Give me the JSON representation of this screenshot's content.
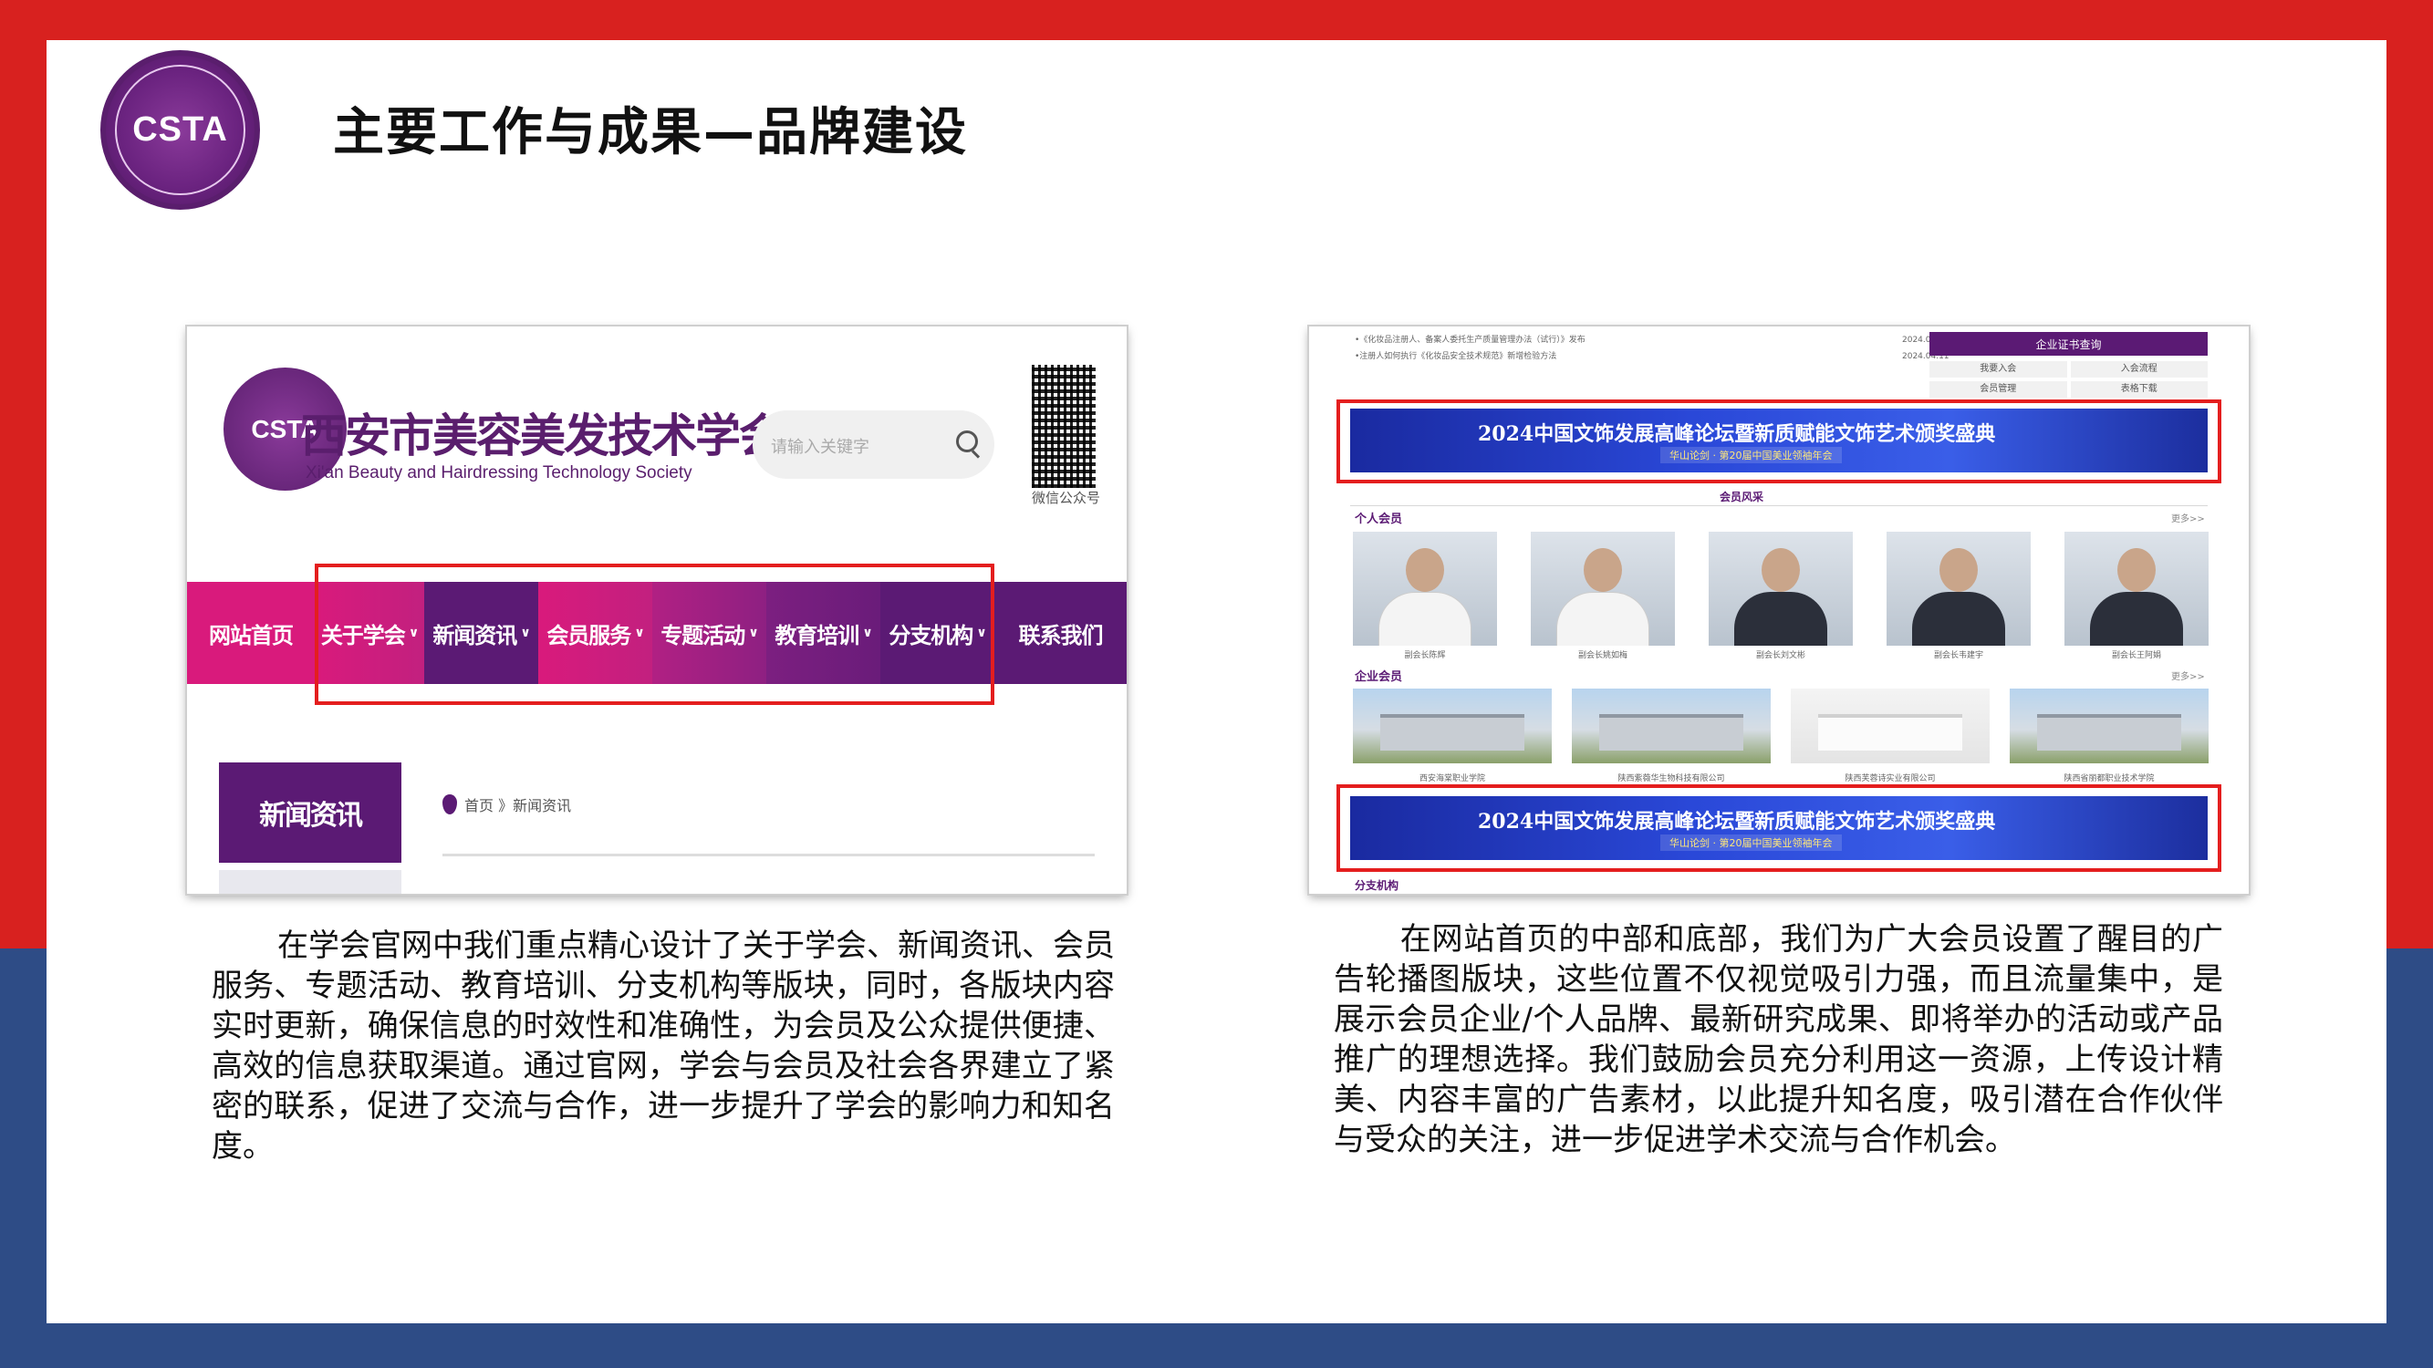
{
  "slide": {
    "title": "主要工作与成果—品牌建设",
    "logo_text": "CSTA",
    "colors": {
      "top_band": "#d8211f",
      "bottom_band": "#2e4c86",
      "brand_purple": "#5b1a74",
      "brand_pink": "#d91a7c",
      "highlight_red": "#e41e1e"
    }
  },
  "shot1": {
    "logo_text": "CSTA",
    "site_name": "西安市美容美发技术学会",
    "site_name_en": "Xi'an Beauty and Hairdressing Technology Society",
    "search_placeholder": "请输入关键字",
    "qr_label": "微信公众号",
    "nav": [
      {
        "label": "网站首页",
        "chevron": ""
      },
      {
        "label": "关于学会",
        "chevron": "∨"
      },
      {
        "label": "新闻资讯",
        "chevron": "∨"
      },
      {
        "label": "会员服务",
        "chevron": "∨"
      },
      {
        "label": "专题活动",
        "chevron": "∨"
      },
      {
        "label": "教育培训",
        "chevron": "∨"
      },
      {
        "label": "分支机构",
        "chevron": "∨"
      },
      {
        "label": "联系我们",
        "chevron": ""
      }
    ],
    "sidebar_tab": "新闻资讯",
    "breadcrumb": "首页 》新闻资讯"
  },
  "shot2": {
    "news": [
      {
        "title": "•《化妆品注册人、备案人委托生产质量管理办法（试行）》发布",
        "date": "2024.04.20"
      },
      {
        "title": "•注册人如何执行《化妆品安全技术规范》新增检验方法",
        "date": "2024.04.11"
      }
    ],
    "cert_title": "企业证书查询",
    "cert_links": [
      "我要入会",
      "入会流程",
      "会员管理",
      "表格下载"
    ],
    "banner_title": "2024中国文饰发展高峰论坛暨新质赋能文饰艺术颁奖盛典",
    "banner_sub": "华山论剑 · 第20届中国美业领袖年会",
    "members_title": "会员风采",
    "individual_title": "个人会员",
    "more": "更多>>",
    "persons": [
      {
        "caption": "副会长陈辉",
        "outfit": "white"
      },
      {
        "caption": "副会长姚如梅",
        "outfit": "white"
      },
      {
        "caption": "副会长刘文彬",
        "outfit": "dark"
      },
      {
        "caption": "副会长韦建宇",
        "outfit": "dark"
      },
      {
        "caption": "副会长王阿娟",
        "outfit": "dark"
      }
    ],
    "enterprise_title": "企业会员",
    "companies": [
      {
        "caption": "西安海棠职业学院",
        "style": "outdoor"
      },
      {
        "caption": "陕西紫薇华生物科技有限公司",
        "style": "outdoor"
      },
      {
        "caption": "陕西芙蓉诗实业有限公司",
        "style": "interior"
      },
      {
        "caption": "陕西省丽都职业技术学院",
        "style": "outdoor"
      }
    ],
    "branch_title": "分支机构"
  },
  "descriptions": {
    "left": "在学会官网中我们重点精心设计了关于学会、新闻资讯、会员服务、专题活动、教育培训、分支机构等版块，同时，各版块内容实时更新，确保信息的时效性和准确性，为会员及公众提供便捷、高效的信息获取渠道。通过官网，学会与会员及社会各界建立了紧密的联系，促进了交流与合作，进一步提升了学会的影响力和知名度。",
    "right": "在网站首页的中部和底部，我们为广大会员设置了醒目的广告轮播图版块，这些位置不仅视觉吸引力强，而且流量集中，是展示会员企业/个人品牌、最新研究成果、即将举办的活动或产品推广的理想选择。我们鼓励会员充分利用这一资源，上传设计精美、内容丰富的广告素材，以此提升知名度，吸引潜在合作伙伴与受众的关注，进一步促进学术交流与合作机会。"
  }
}
